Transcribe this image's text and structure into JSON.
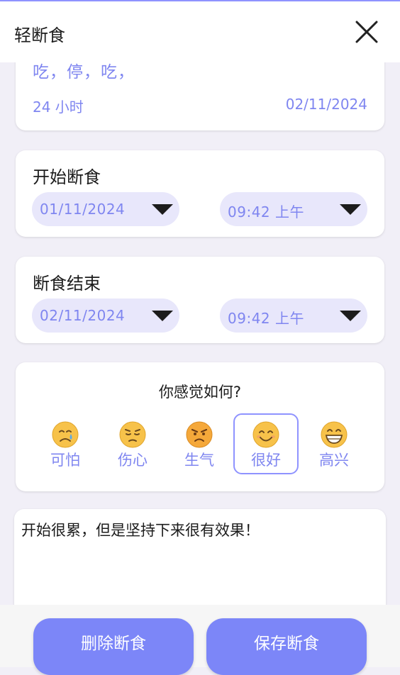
{
  "header": {
    "title": "轻断食"
  },
  "summary": {
    "pattern": "吃，停，吃，",
    "duration": "24 小时",
    "date": "02/11/2024"
  },
  "start": {
    "title": "开始断食",
    "date": "01/11/2024",
    "time": "09:42 上午"
  },
  "end": {
    "title": "断食结束",
    "date": "02/11/2024",
    "time": "09:42 上午"
  },
  "feeling": {
    "title": "你感觉如何?",
    "selected": "很好",
    "moods": [
      {
        "label": "可怕",
        "icon": "crying-face-icon"
      },
      {
        "label": "伤心",
        "icon": "pensive-face-icon"
      },
      {
        "label": "生气",
        "icon": "angry-face-icon"
      },
      {
        "label": "很好",
        "icon": "smiling-face-icon"
      },
      {
        "label": "高兴",
        "icon": "grinning-face-icon"
      }
    ]
  },
  "notes": {
    "text": "开始很累，但是坚持下来很有效果！"
  },
  "actions": {
    "delete_label": "删除断食",
    "save_label": "保存断食"
  },
  "colors": {
    "accent": "#7c86f8",
    "accent_text": "#7f86f0",
    "pill_bg": "#e8e7fb",
    "page_bg": "#f1eff7"
  }
}
